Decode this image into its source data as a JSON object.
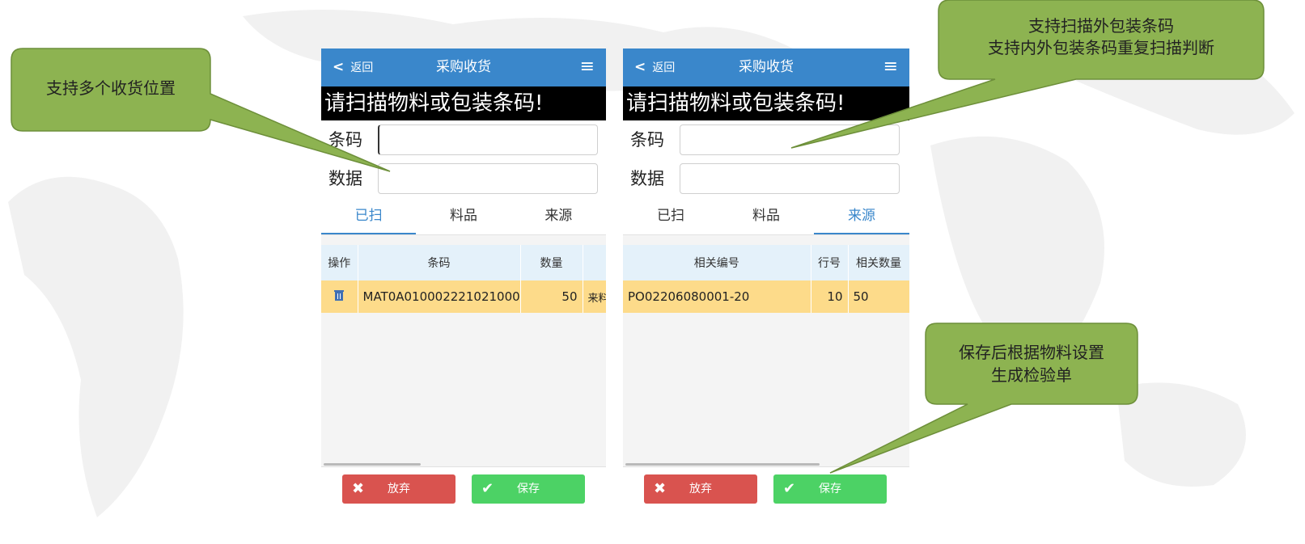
{
  "colors": {
    "header_blue": "#3a87cb",
    "table_header": "#e4f1fa",
    "row_highlight": "#fddb8a",
    "discard_red": "#d9534f",
    "save_green": "#4cd265",
    "callout_green": "#8db351"
  },
  "screens": [
    {
      "header": {
        "back_label": "返回",
        "title": "采购收货",
        "menu_icon": "hamburger-icon"
      },
      "prompt": "请扫描物料或包装条码!",
      "fields": {
        "barcode_label": "条码",
        "barcode_value": "",
        "data_label": "数据",
        "data_value": ""
      },
      "tabs": [
        "已扫",
        "料品",
        "来源"
      ],
      "active_tab": "已扫",
      "table": {
        "columns": [
          "操作",
          "条码",
          "数量"
        ],
        "rows": [
          {
            "action_icon": "delete-icon",
            "barcode": "MAT0A010002221021000",
            "qty": "50",
            "extra": "来料"
          }
        ]
      },
      "buttons": {
        "discard": "放弃",
        "save": "保存"
      }
    },
    {
      "header": {
        "back_label": "返回",
        "title": "采购收货",
        "menu_icon": "hamburger-icon"
      },
      "prompt": "请扫描物料或包装条码!",
      "fields": {
        "barcode_label": "条码",
        "barcode_value": "",
        "data_label": "数据",
        "data_value": ""
      },
      "tabs": [
        "已扫",
        "料品",
        "来源"
      ],
      "active_tab": "来源",
      "table": {
        "columns": [
          "相关编号",
          "行号",
          "相关数量"
        ],
        "rows": [
          {
            "ref_no": "PO02206080001-20",
            "line_no": "10",
            "ref_qty": "50"
          }
        ]
      },
      "buttons": {
        "discard": "放弃",
        "save": "保存"
      }
    }
  ],
  "callouts": {
    "multi_location": "支持多个收货位置",
    "outer_package_line1": "支持扫描外包装条码",
    "outer_package_line2": "支持内外包装条码重复扫描判断",
    "inspection_line1": "保存后根据物料设置",
    "inspection_line2": "生成检验单"
  }
}
